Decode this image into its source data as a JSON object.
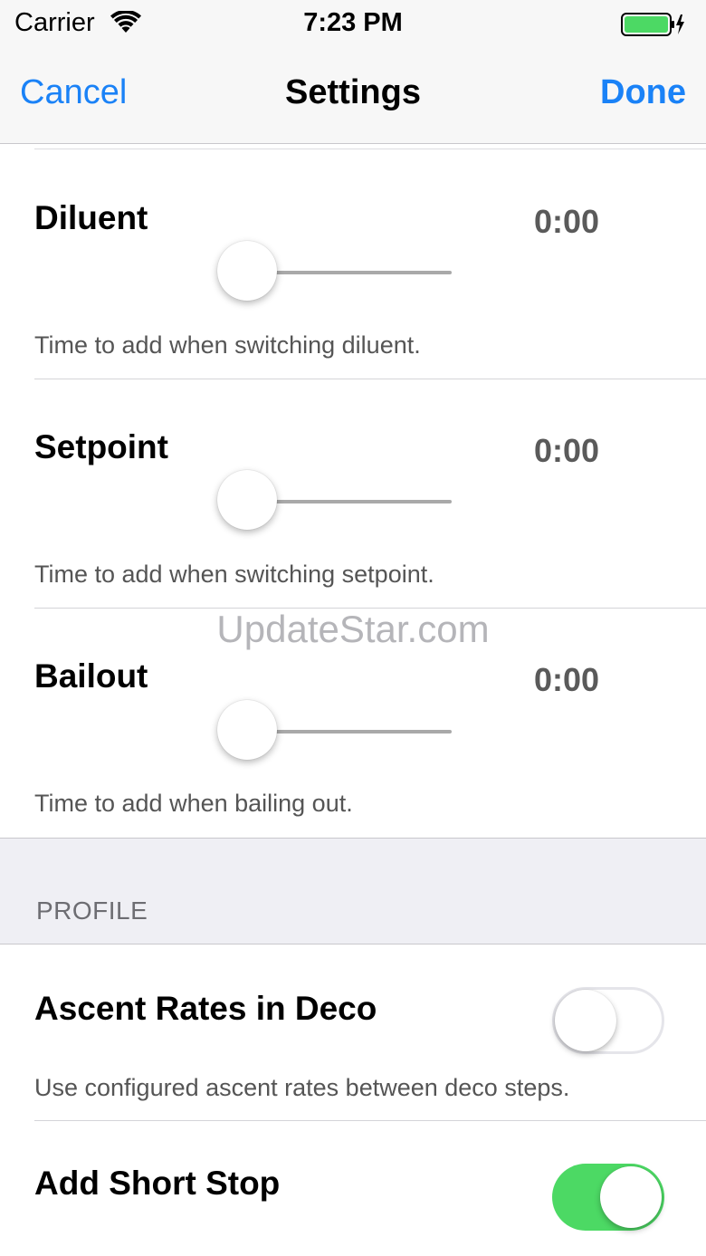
{
  "status_bar": {
    "carrier": "Carrier",
    "time": "7:23 PM",
    "wifi_icon": "wifi-icon",
    "battery_icon": "battery-icon",
    "battery_color": "#4cd964"
  },
  "nav": {
    "cancel_label": "Cancel",
    "title": "Settings",
    "done_label": "Done",
    "tint_color": "#1a82f7"
  },
  "rows": {
    "diluent": {
      "title": "Diluent",
      "value": "0:00",
      "slider_fraction": 0,
      "description": "Time to add when switching diluent."
    },
    "setpoint": {
      "title": "Setpoint",
      "value": "0:00",
      "slider_fraction": 0,
      "description": "Time to add when switching setpoint."
    },
    "bailout": {
      "title": "Bailout",
      "value": "0:00",
      "slider_fraction": 0,
      "description": "Time to add when bailing out."
    }
  },
  "profile_section": {
    "header": "PROFILE",
    "ascent_rates": {
      "title": "Ascent Rates in Deco",
      "description": "Use configured ascent rates between deco steps.",
      "enabled": false
    },
    "short_stop": {
      "title": "Add Short Stop",
      "enabled": true
    }
  },
  "watermark": "UpdateStar.com",
  "colors": {
    "switch_on": "#4cd964",
    "section_background": "#efeff4"
  }
}
